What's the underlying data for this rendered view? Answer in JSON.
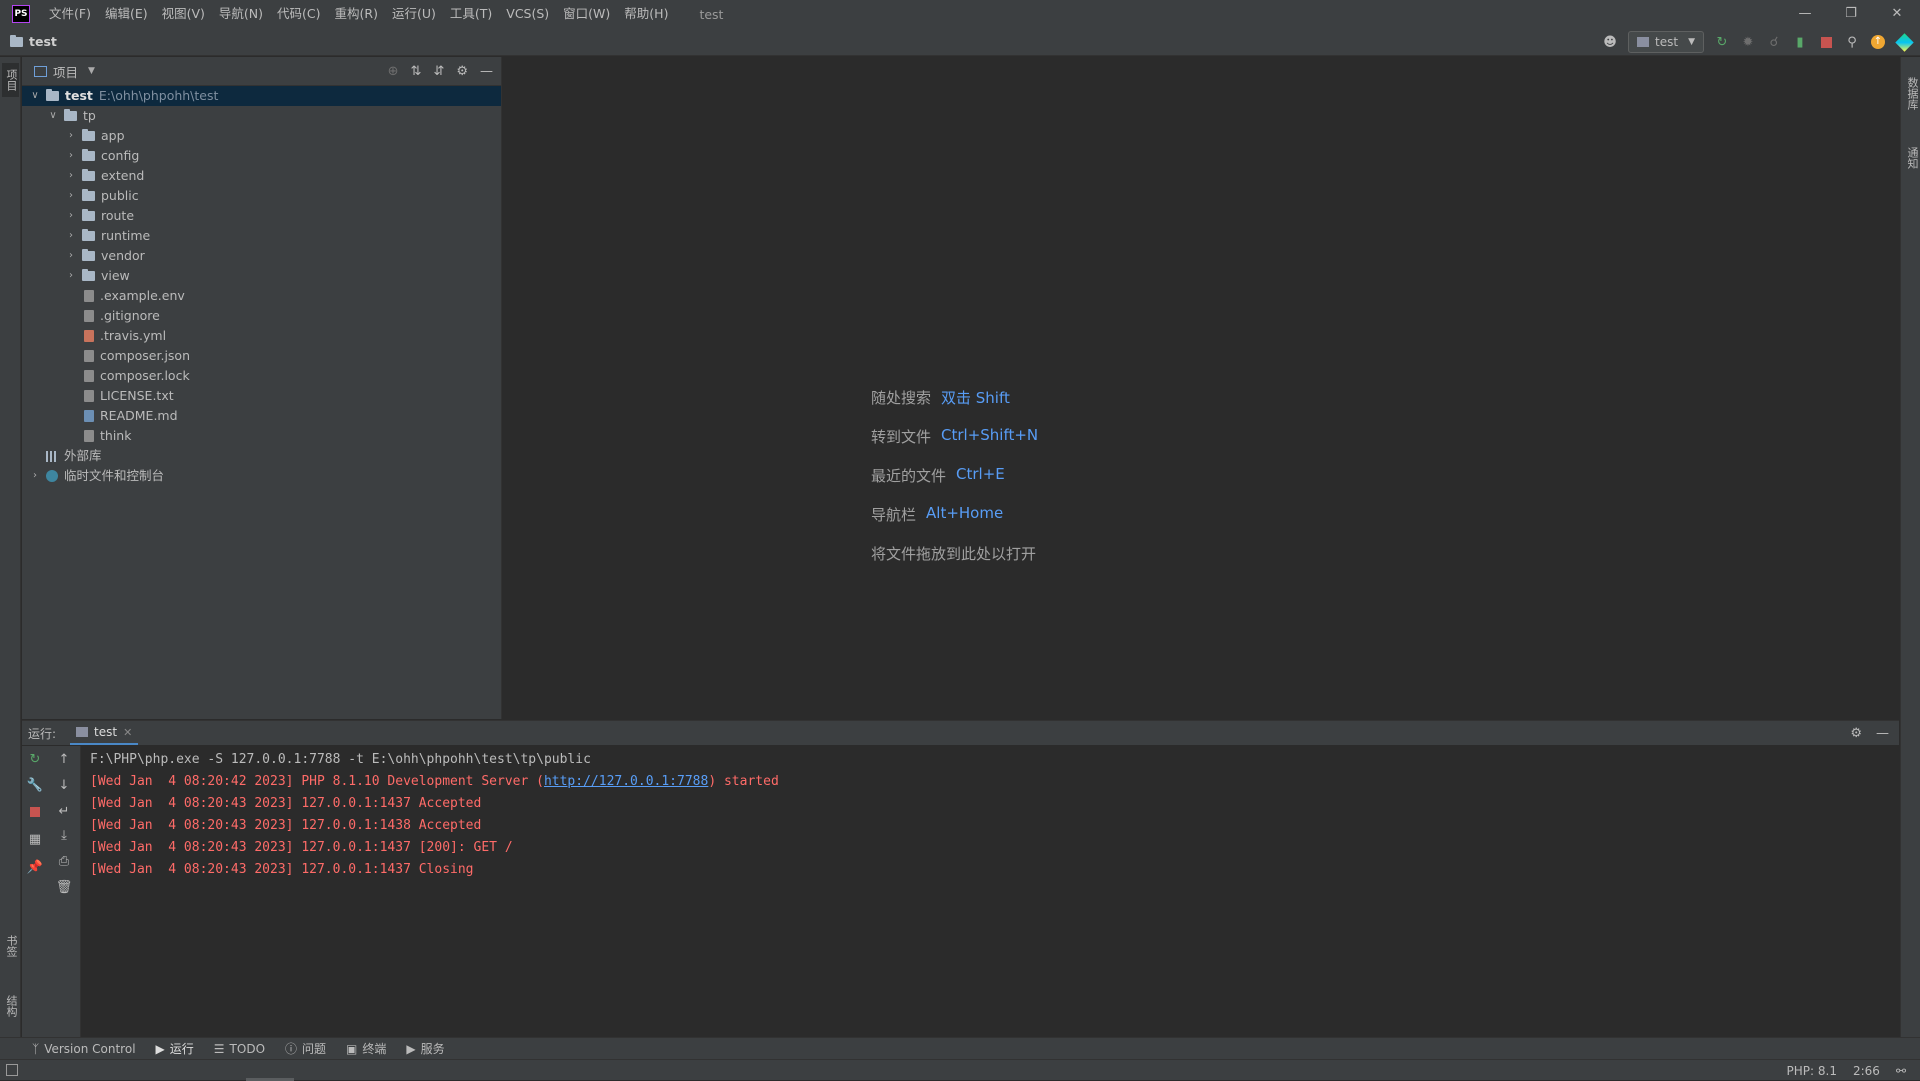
{
  "app": {
    "logo": "PS",
    "window_title": "test",
    "menu": [
      "文件(F)",
      "编辑(E)",
      "视图(V)",
      "导航(N)",
      "代码(C)",
      "重构(R)",
      "运行(U)",
      "工具(T)",
      "VCS(S)",
      "窗口(W)",
      "帮助(H)"
    ]
  },
  "navbar": {
    "crumb": "test",
    "run_config": "test"
  },
  "left_strip": {
    "top_tab": "项目",
    "bottom_tab1": "书签",
    "bottom_tab2": "结构"
  },
  "right_strip": {
    "tab1": "数据库",
    "tab2": "通知"
  },
  "project_panel": {
    "title": "项目",
    "root": {
      "name": "test",
      "path": "E:\\ohh\\phpohh\\test"
    },
    "tp": "tp",
    "folders": [
      "app",
      "config",
      "extend",
      "public",
      "route",
      "runtime",
      "vendor",
      "view"
    ],
    "files": [
      {
        "name": ".example.env",
        "kind": "txt"
      },
      {
        "name": ".gitignore",
        "kind": "txt"
      },
      {
        "name": ".travis.yml",
        "kind": "yml"
      },
      {
        "name": "composer.json",
        "kind": "txt"
      },
      {
        "name": "composer.lock",
        "kind": "txt"
      },
      {
        "name": "LICENSE.txt",
        "kind": "txt"
      },
      {
        "name": "README.md",
        "kind": "md"
      },
      {
        "name": "think",
        "kind": "txt"
      }
    ],
    "external_libs": "外部库",
    "scratches": "临时文件和控制台"
  },
  "editor_hints": [
    {
      "label": "随处搜索",
      "key": "双击 Shift"
    },
    {
      "label": "转到文件",
      "key": "Ctrl+Shift+N"
    },
    {
      "label": "最近的文件",
      "key": "Ctrl+E"
    },
    {
      "label": "导航栏",
      "key": "Alt+Home"
    },
    {
      "label": "将文件拖放到此处以打开",
      "key": ""
    }
  ],
  "run_panel": {
    "label": "运行:",
    "tab": "test",
    "console": {
      "command": "F:\\PHP\\php.exe -S 127.0.0.1:7788 -t E:\\ohh\\phpohh\\test\\tp\\public",
      "line1_pre": "[Wed Jan  4 08:20:42 2023] PHP 8.1.10 Development Server (",
      "line1_link": "http://127.0.0.1:7788",
      "line1_post": ") started",
      "lines": [
        "[Wed Jan  4 08:20:43 2023] 127.0.0.1:1437 Accepted",
        "[Wed Jan  4 08:20:43 2023] 127.0.0.1:1438 Accepted",
        "[Wed Jan  4 08:20:43 2023] 127.0.0.1:1437 [200]: GET /",
        "[Wed Jan  4 08:20:43 2023] 127.0.0.1:1437 Closing"
      ]
    }
  },
  "bottom_tabs": [
    "Version Control",
    "运行",
    "TODO",
    "问题",
    "终端",
    "服务"
  ],
  "status": {
    "php": "PHP: 8.1",
    "pos": "2:66"
  },
  "colors": {
    "accent": "#589df6",
    "error_text": "#ff6b68",
    "selection": "#0d293e"
  }
}
